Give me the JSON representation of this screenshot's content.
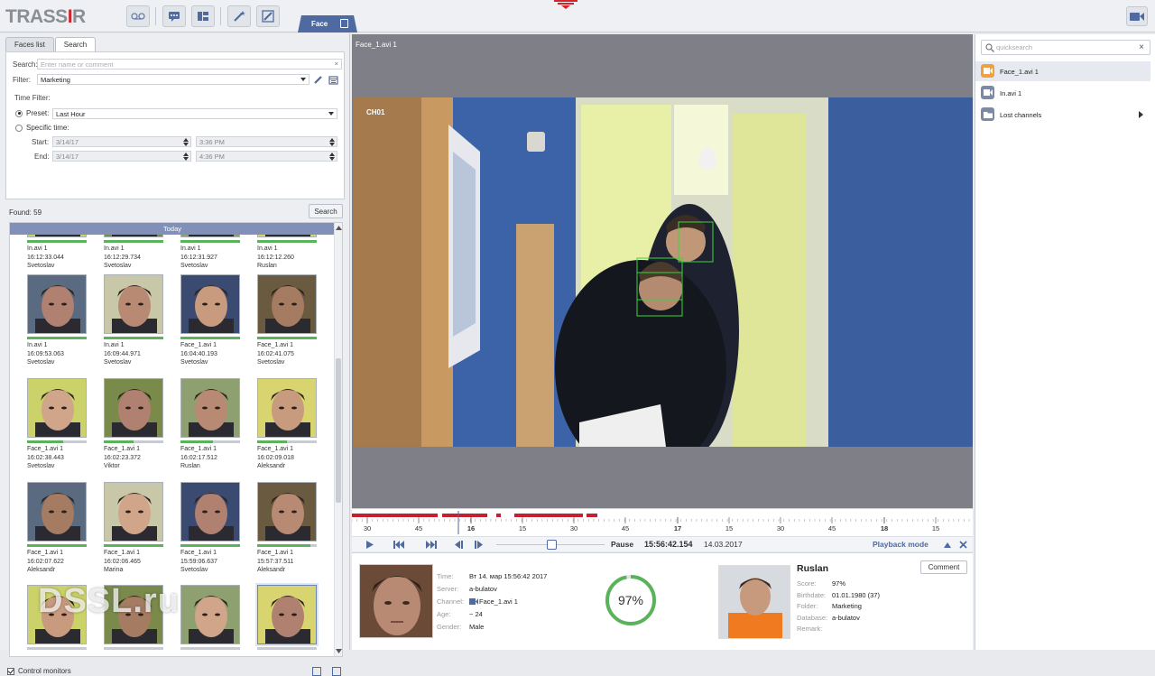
{
  "app": {
    "logo_main": "TRASS",
    "logo_r": "I",
    "logo_tail": "R",
    "active_tab": "Face",
    "watermark": "DSSL.ru"
  },
  "colors": {
    "accent": "#4f6aa1",
    "good": "#5ab35a",
    "brand_red": "#d4232b",
    "orange": "#f0a040"
  },
  "left": {
    "tabs": [
      "Faces list",
      "Search"
    ],
    "search_label": "Search:",
    "search_placeholder": "Enter name or comment",
    "filter_label": "Filter:",
    "filter_value": "Marketing",
    "time_filter_label": "Time Filter:",
    "preset_label": "Preset:",
    "preset_value": "Last Hour",
    "specific_label": "Specific time:",
    "start_label": "Start:",
    "end_label": "End:",
    "start_date": "3/14/17",
    "start_time": "3:36 PM",
    "end_date": "3/14/17",
    "end_time": "4:36 PM",
    "found": "Found: 59",
    "search_button": "Search",
    "today": "Today",
    "control_monitors": "Control monitors"
  },
  "results": [
    {
      "file": "In.avi 1",
      "time": "16:12:33.044",
      "name": "Svetoslav",
      "q": 1.0
    },
    {
      "file": "In.avi 1",
      "time": "16:12:29.734",
      "name": "Svetoslav",
      "q": 1.0
    },
    {
      "file": "In.avi 1",
      "time": "16:12:31.927",
      "name": "Svetoslav",
      "q": 1.0
    },
    {
      "file": "In.avi 1",
      "time": "16:12:12.260",
      "name": "Ruslan",
      "q": 1.0
    },
    {
      "file": "In.avi 1",
      "time": "16:09:53.063",
      "name": "Svetoslav",
      "q": 1.0
    },
    {
      "file": "In.avi 1",
      "time": "16:09:44.971",
      "name": "Svetoslav",
      "q": 1.0
    },
    {
      "file": "Face_1.avi 1",
      "time": "16:04:40.193",
      "name": "Svetoslav",
      "q": 1.0
    },
    {
      "file": "Face_1.avi 1",
      "time": "16:02:41.075",
      "name": "Svetoslav",
      "q": 1.0
    },
    {
      "file": "Face_1.avi 1",
      "time": "16:02:38.443",
      "name": "Svetoslav",
      "q": 0.6
    },
    {
      "file": "Face_1.avi 1",
      "time": "16:02:23.372",
      "name": "Viktor",
      "q": 0.5
    },
    {
      "file": "Face_1.avi 1",
      "time": "16:02:17.512",
      "name": "Ruslan",
      "q": 0.55
    },
    {
      "file": "Face_1.avi 1",
      "time": "16:02:09.018",
      "name": "Aleksandr",
      "q": 0.5
    },
    {
      "file": "Face_1.avi 1",
      "time": "16:02:07.622",
      "name": "Aleksandr",
      "q": 1.0
    },
    {
      "file": "Face_1.avi 1",
      "time": "16:02:06.465",
      "name": "Marina",
      "q": 1.0
    },
    {
      "file": "Face_1.avi 1",
      "time": "15:59:06.637",
      "name": "Svetoslav",
      "q": 1.0
    },
    {
      "file": "Face_1.avi 1",
      "time": "15:57:37.511",
      "name": "Aleksandr",
      "q": 0.9
    },
    {
      "file": "",
      "time": "",
      "name": "",
      "q": 0
    },
    {
      "file": "",
      "time": "",
      "name": "",
      "q": 0
    },
    {
      "file": "",
      "time": "",
      "name": "",
      "q": 0
    },
    {
      "file": "",
      "time": "",
      "name": "",
      "q": 0
    }
  ],
  "video": {
    "title": "Face_1.avi 1",
    "channel_label": "CH01"
  },
  "timeline": {
    "ticks": [
      "30",
      "45",
      "16",
      "15",
      "30",
      "45",
      "17",
      "15",
      "30",
      "45",
      "18",
      "15"
    ],
    "pause": "Pause",
    "time": "15:56:42.154",
    "date": "14.03.2017",
    "mode": "Playback mode"
  },
  "info": {
    "fields": [
      {
        "key": "Time:",
        "value": "Вт 14. мар 15:56:42 2017"
      },
      {
        "key": "Server:",
        "value": "a-bulatov"
      },
      {
        "key": "Channel:",
        "value": "Face_1.avi 1"
      },
      {
        "key": "Age:",
        "value": "~ 24"
      },
      {
        "key": "Gender:",
        "value": "Male"
      }
    ],
    "score_text": "97%",
    "score": 0.97
  },
  "match": {
    "name": "Ruslan",
    "fields": [
      {
        "key": "Score:",
        "value": "97%"
      },
      {
        "key": "Birthdate:",
        "value": "01.01.1980 (37)"
      },
      {
        "key": "Folder:",
        "value": "Marketing"
      },
      {
        "key": "Database:",
        "value": "a-bulatov"
      },
      {
        "key": "Remark:",
        "value": ""
      }
    ],
    "comment_button": "Comment"
  },
  "right": {
    "quicksearch_placeholder": "quicksearch",
    "items": [
      "Face_1.avi 1",
      "In.avi 1",
      "Lost channels"
    ]
  }
}
